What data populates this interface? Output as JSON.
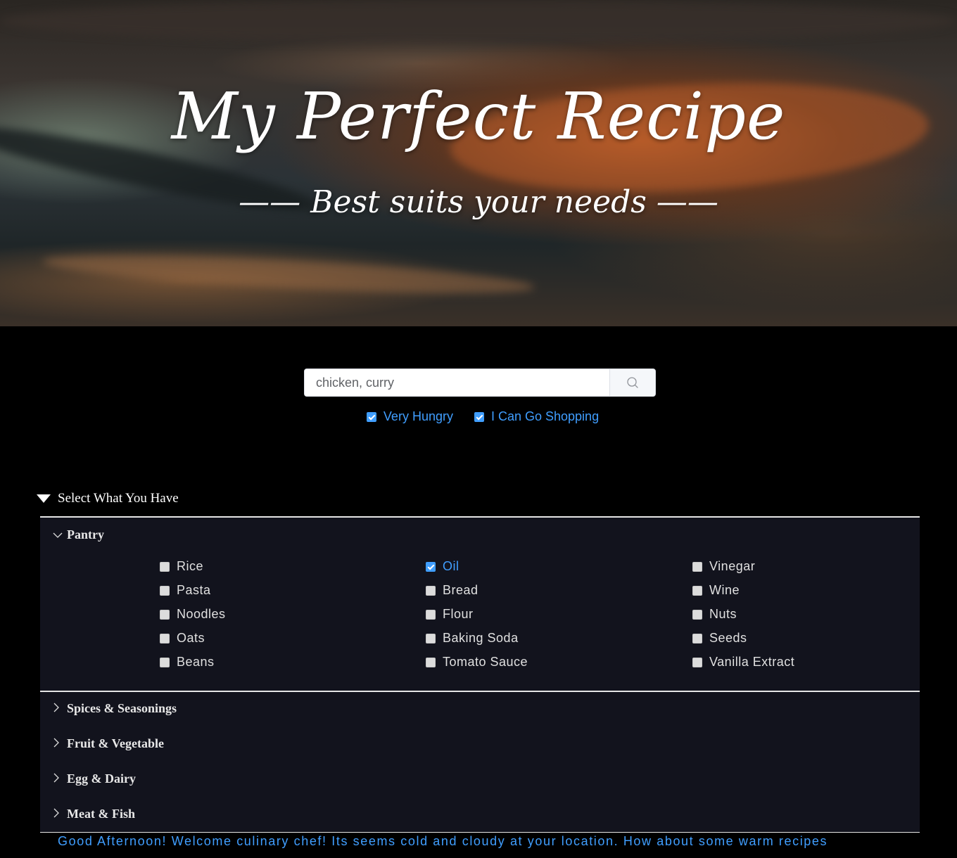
{
  "hero": {
    "title": "My Perfect Recipe",
    "subtitle": "—— Best suits your needs ——"
  },
  "search": {
    "value": "chicken, curry",
    "placeholder": "",
    "icon": "search-icon"
  },
  "preferences": [
    {
      "label": "Very Hungry",
      "checked": true
    },
    {
      "label": "I Can Go Shopping",
      "checked": true
    }
  ],
  "select_section": {
    "label": "Select What You Have",
    "expanded": true
  },
  "categories": {
    "pantry": {
      "label": "Pantry",
      "expanded": true,
      "items": [
        {
          "label": "Rice",
          "checked": false
        },
        {
          "label": "Pasta",
          "checked": false
        },
        {
          "label": "Noodles",
          "checked": false
        },
        {
          "label": "Oats",
          "checked": false
        },
        {
          "label": "Beans",
          "checked": false
        },
        {
          "label": "Oil",
          "checked": true
        },
        {
          "label": "Bread",
          "checked": false
        },
        {
          "label": "Flour",
          "checked": false
        },
        {
          "label": "Baking Soda",
          "checked": false
        },
        {
          "label": "Tomato Sauce",
          "checked": false
        },
        {
          "label": "Vinegar",
          "checked": false
        },
        {
          "label": "Wine",
          "checked": false
        },
        {
          "label": "Nuts",
          "checked": false
        },
        {
          "label": "Seeds",
          "checked": false
        },
        {
          "label": "Vanilla Extract",
          "checked": false
        }
      ]
    },
    "spices": {
      "label": "Spices & Seasonings",
      "expanded": false
    },
    "fruit_veg": {
      "label": "Fruit & Vegetable",
      "expanded": false
    },
    "egg_dairy": {
      "label": "Egg & Dairy",
      "expanded": false
    },
    "meat_fish": {
      "label": "Meat & Fish",
      "expanded": false
    }
  },
  "greeting": "Good Afternoon! Welcome culinary chef! Its seems cold and cloudy at your location. How about some warm recipes",
  "colors": {
    "accent": "#409eff",
    "panel_bg": "#12131d",
    "page_bg": "#000000"
  }
}
